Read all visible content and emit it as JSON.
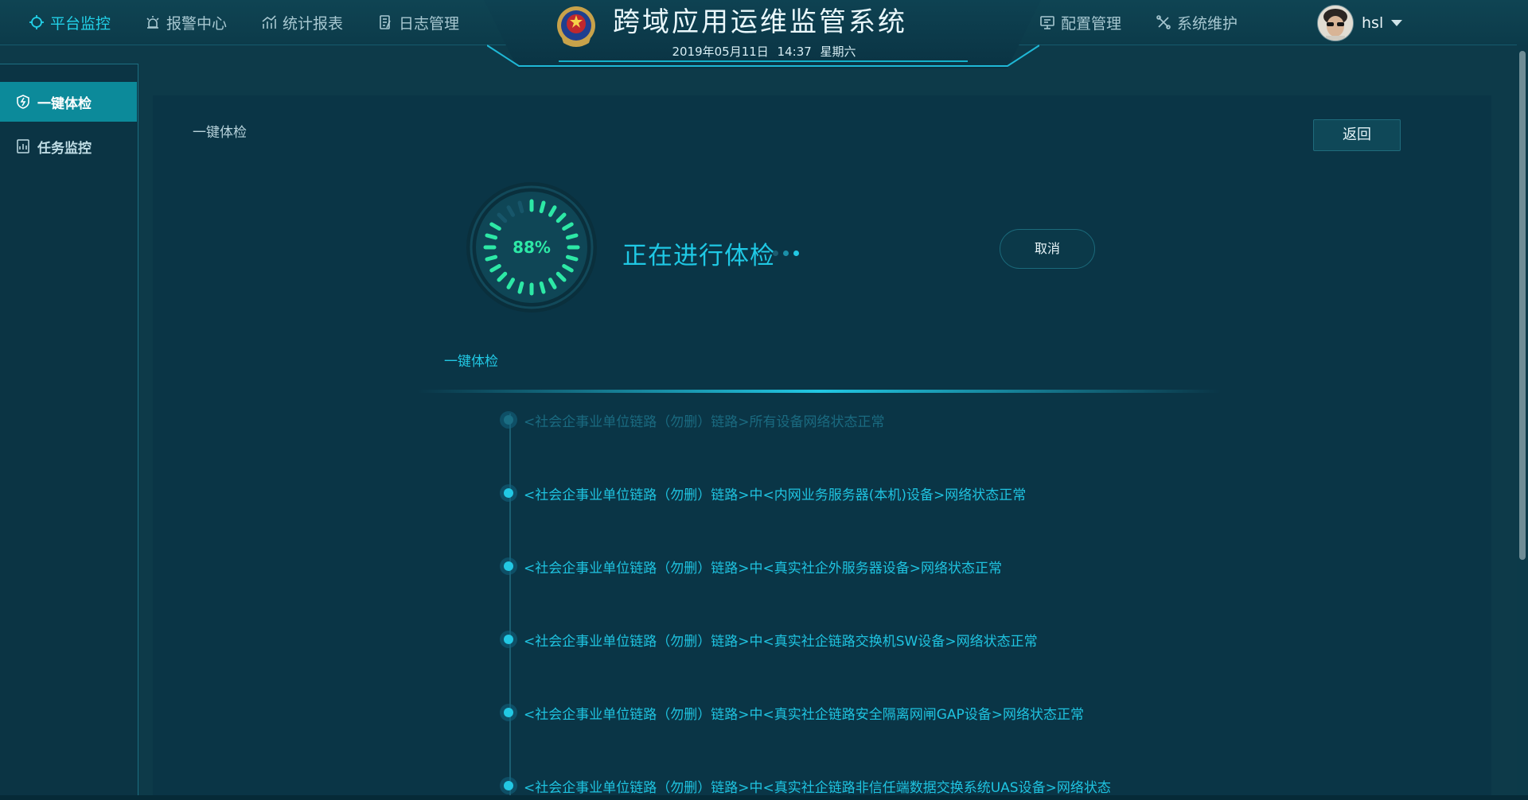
{
  "header": {
    "app_title": "跨域应用运维监管系统",
    "datetime": "2019年05月11日  14:37  星期六",
    "nav_left": [
      {
        "label": "平台监控",
        "icon": "crosshair-icon"
      },
      {
        "label": "报警中心",
        "icon": "alarm-light-icon"
      },
      {
        "label": "统计报表",
        "icon": "chart-icon"
      },
      {
        "label": "日志管理",
        "icon": "log-icon"
      }
    ],
    "nav_right": [
      {
        "label": "配置管理",
        "icon": "monitor-icon"
      },
      {
        "label": "系统维护",
        "icon": "tools-icon"
      }
    ],
    "username": "hsl"
  },
  "sidebar": {
    "items": [
      {
        "label": "一键体检",
        "icon": "shield-bolt-icon",
        "active": true
      },
      {
        "label": "任务监控",
        "icon": "report-icon",
        "active": false
      }
    ]
  },
  "main": {
    "panel_label": "一键体检",
    "back_label": "返回",
    "progress": {
      "percent_label": "88%",
      "value": 88
    },
    "status": "正在进行体检",
    "cancel_label": "取消",
    "section_label": "一键体检",
    "log_items": [
      "<社会企事业单位链路（勿删）链路>所有设备网络状态正常",
      "<社会企事业单位链路（勿删）链路>中<内网业务服务器(本机)设备>网络状态正常",
      "<社会企事业单位链路（勿删）链路>中<真实社企外服务器设备>网络状态正常",
      "<社会企事业单位链路（勿删）链路>中<真实社企链路交换机SW设备>网络状态正常",
      "<社会企事业单位链路（勿删）链路>中<真实社企链路安全隔离网闸GAP设备>网络状态正常",
      "<社会企事业单位链路（勿删）链路>中<真实社企链路非信任端数据交换系统UAS设备>网络状态"
    ]
  },
  "colors": {
    "accent": "#22c8e4",
    "progress": "#2de8a6",
    "background": "#0d3a49",
    "panel": "#0a3546",
    "sidebar_active": "#0c8a9a"
  }
}
